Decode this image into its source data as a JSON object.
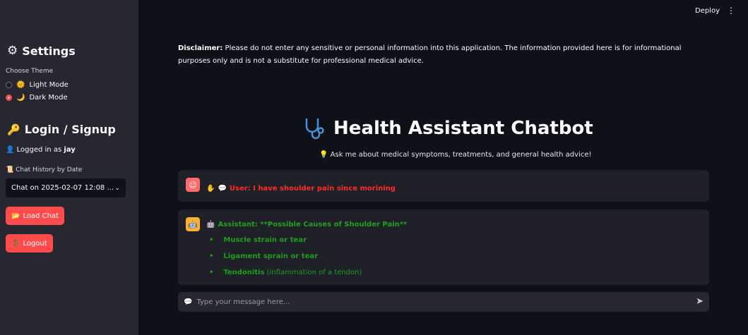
{
  "header": {
    "deploy_label": "Deploy",
    "more_icon": "⋮"
  },
  "sidebar": {
    "settings_title": "Settings",
    "theme_label": "Choose Theme",
    "theme_options": [
      {
        "icon": "🌞",
        "label": "Light Mode",
        "selected": false
      },
      {
        "icon": "🌙",
        "label": "Dark Mode",
        "selected": true
      }
    ],
    "login_title": "Login / Signup",
    "logged_in_prefix": "Logged in as",
    "username": "jay",
    "history_label": "Chat History by Date",
    "history_selected": "Chat on 2025-02-07 12:08 ...",
    "load_button": "Load Chat",
    "logout_button": "Logout"
  },
  "main": {
    "disclaimer_prefix": "Disclaimer:",
    "disclaimer_text": " Please do not enter any sensitive or personal information into this application. The information provided here is for informational purposes only and is not a substitute for professional medical advice.",
    "title": "Health Assistant Chatbot",
    "subtitle": "Ask me about medical symptoms, treatments, and general health advice!",
    "messages": [
      {
        "role": "user",
        "text": "User: I have shoulder pain since morining"
      },
      {
        "role": "assistant",
        "text": "Assistant: **Possible Causes of Shoulder Pain**",
        "items": [
          {
            "bold": "Muscle strain or tear",
            "rest": ""
          },
          {
            "bold": "Ligament sprain or tear",
            "rest": ""
          },
          {
            "bold": "Tendonitis",
            "rest": " (inflammation of a tendon)"
          }
        ]
      }
    ],
    "input_placeholder": "Type your message here..."
  },
  "colors": {
    "accent": "#ff4b4b",
    "user_text": "#ff2b2b",
    "assistant_text": "#1e9c1e",
    "sidebar_bg": "#262730",
    "main_bg": "#0e1117"
  }
}
